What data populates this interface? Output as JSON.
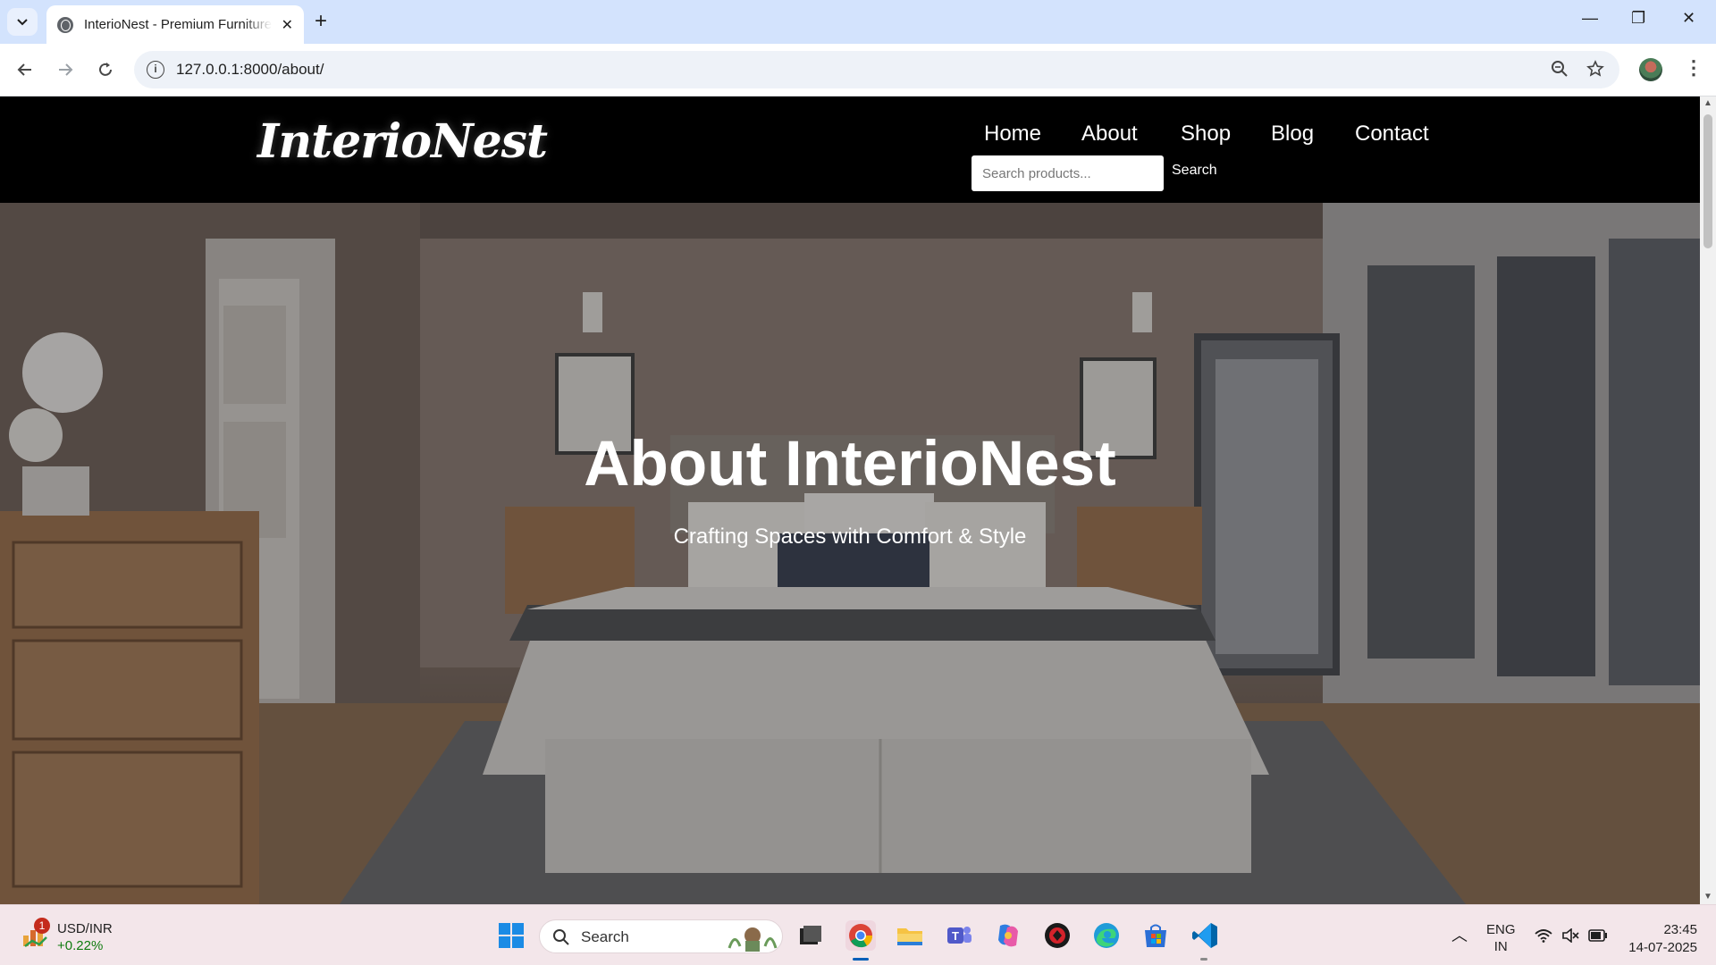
{
  "browser": {
    "tab_title": "InterioNest - Premium Furniture",
    "url": "127.0.0.1:8000/about/"
  },
  "site": {
    "logo": "InterioNest",
    "nav": [
      "Home",
      "About",
      "Shop",
      "Blog",
      "Contact"
    ],
    "search_placeholder": "Search products...",
    "search_button": "Search"
  },
  "hero": {
    "title": "About InterioNest",
    "subtitle": "Crafting Spaces with Comfort & Style"
  },
  "taskbar": {
    "notification_count": "1",
    "ticker_name": "USD/INR",
    "ticker_change": "+0.22%",
    "search_label": "Search",
    "lang_line1": "ENG",
    "lang_line2": "IN",
    "time": "23:45",
    "date": "14-07-2025"
  }
}
